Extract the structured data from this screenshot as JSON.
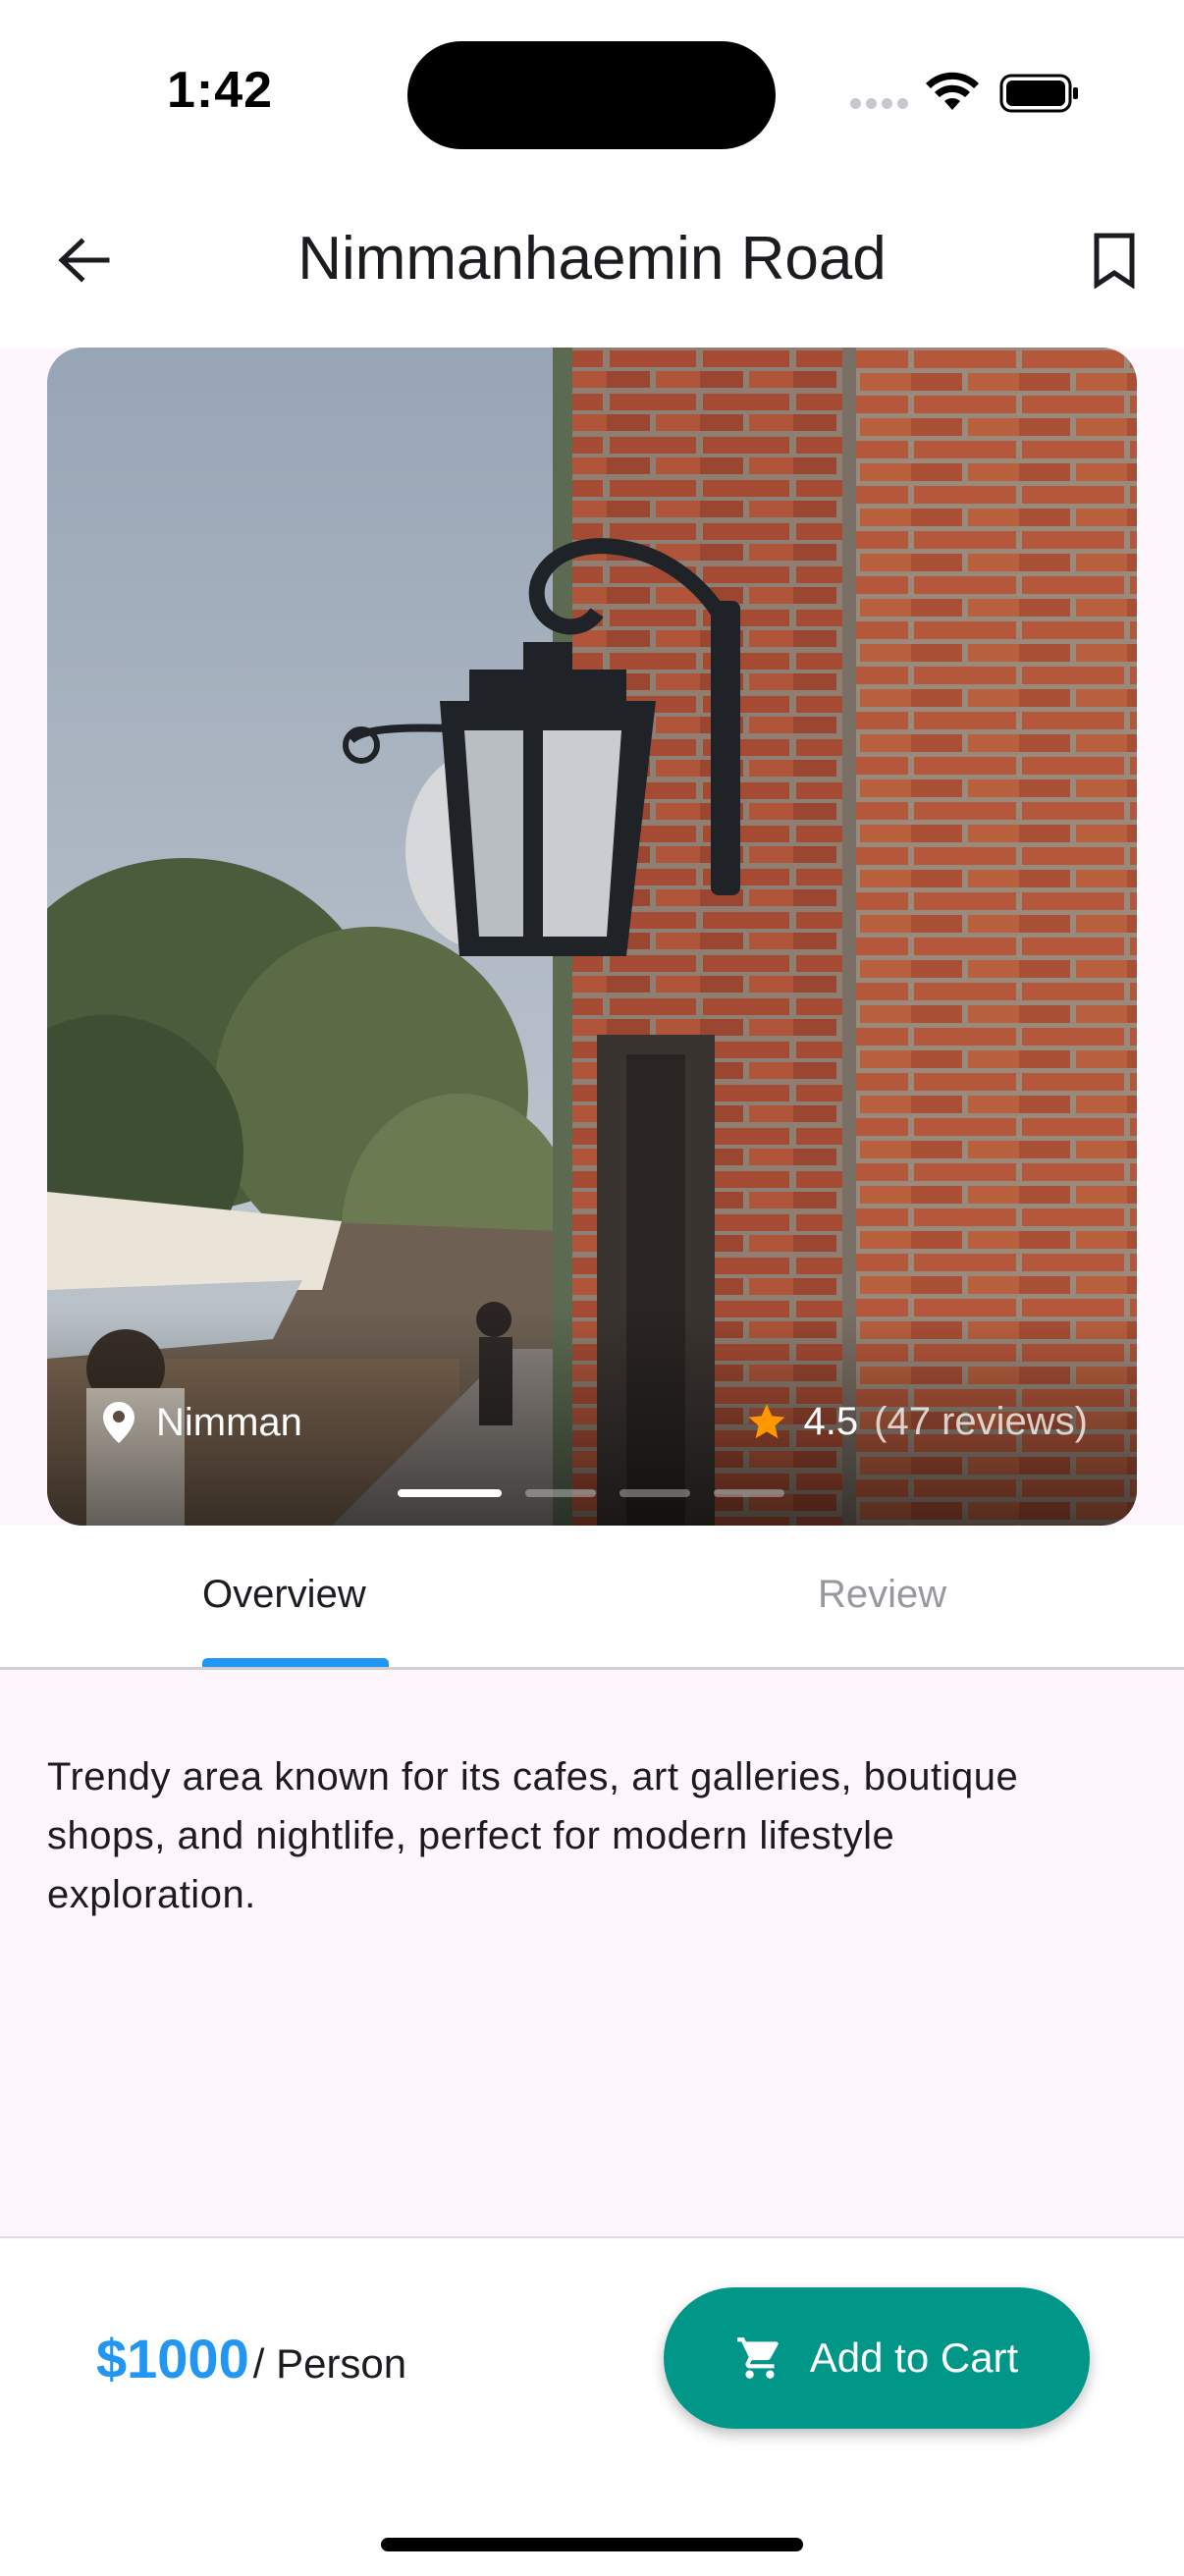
{
  "status_bar": {
    "time": "1:42"
  },
  "header": {
    "title": "Nimmanhaemin Road",
    "back_icon": "arrow-left-icon",
    "bookmark_icon": "bookmark-outline-icon"
  },
  "hero": {
    "location": "Nimman",
    "rating": "4.5",
    "reviews": "(47 reviews)",
    "carousel_count": 4,
    "carousel_active": 1
  },
  "tabs": [
    {
      "label": "Overview",
      "selected": true
    },
    {
      "label": "Review",
      "selected": false
    }
  ],
  "description": "Trendy area known for its cafes, art galleries, boutique shops, and nightlife, perfect for modern lifestyle exploration.",
  "bottom": {
    "price": "$1000",
    "per": "/ Person",
    "cart_label": "Add to Cart"
  },
  "colors": {
    "accent": "#2196f3",
    "cart_button": "#009688",
    "star": "#ff9800",
    "background": "#fdf6fd"
  }
}
